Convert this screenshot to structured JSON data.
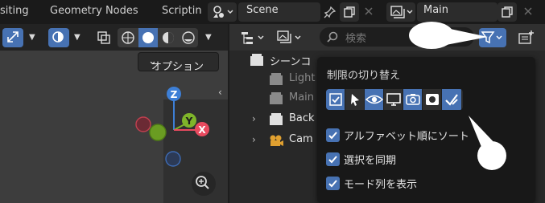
{
  "workspace_tabs": [
    "siting",
    "Geometry Nodes",
    "Scriptin"
  ],
  "scene": {
    "label": "Scene"
  },
  "view_layer": {
    "label": "Main"
  },
  "viewport": {
    "options_label": "オプション",
    "gizmo": {
      "z": "Z",
      "y": "Y",
      "x": "X"
    }
  },
  "outliner": {
    "search_placeholder": "検索",
    "rows": [
      {
        "label": "シーンコ",
        "icon": "collection-icon",
        "dim": false
      },
      {
        "label": "Light",
        "icon": "collection-icon",
        "dim": true
      },
      {
        "label": "Main",
        "icon": "collection-icon",
        "dim": true
      },
      {
        "label": "Back",
        "icon": "collection-icon",
        "dim": false
      },
      {
        "label": "Cam",
        "icon": "camera-icon",
        "dim": false
      }
    ]
  },
  "filter_popup": {
    "title": "制限の切り替え",
    "toggles": [
      {
        "icon": "checkbox-icon",
        "on": true
      },
      {
        "icon": "cursor-icon",
        "on": false
      },
      {
        "icon": "eye-icon",
        "on": true
      },
      {
        "icon": "monitor-icon",
        "on": false
      },
      {
        "icon": "camera-icon",
        "on": true
      },
      {
        "icon": "holdout-icon",
        "on": false
      },
      {
        "icon": "indirect-icon",
        "on": true
      }
    ],
    "options": [
      {
        "label": "アルファベット順にソート",
        "checked": true
      },
      {
        "label": "選択を同期",
        "checked": true
      },
      {
        "label": "モード列を表示",
        "checked": true
      }
    ]
  },
  "colors": {
    "accent": "#4772b3",
    "background": "#1d1d1d",
    "popup_bg": "#181818",
    "axis_x": "#e84a5f",
    "axis_y": "#7fb52a",
    "axis_z": "#3d7fd6"
  }
}
